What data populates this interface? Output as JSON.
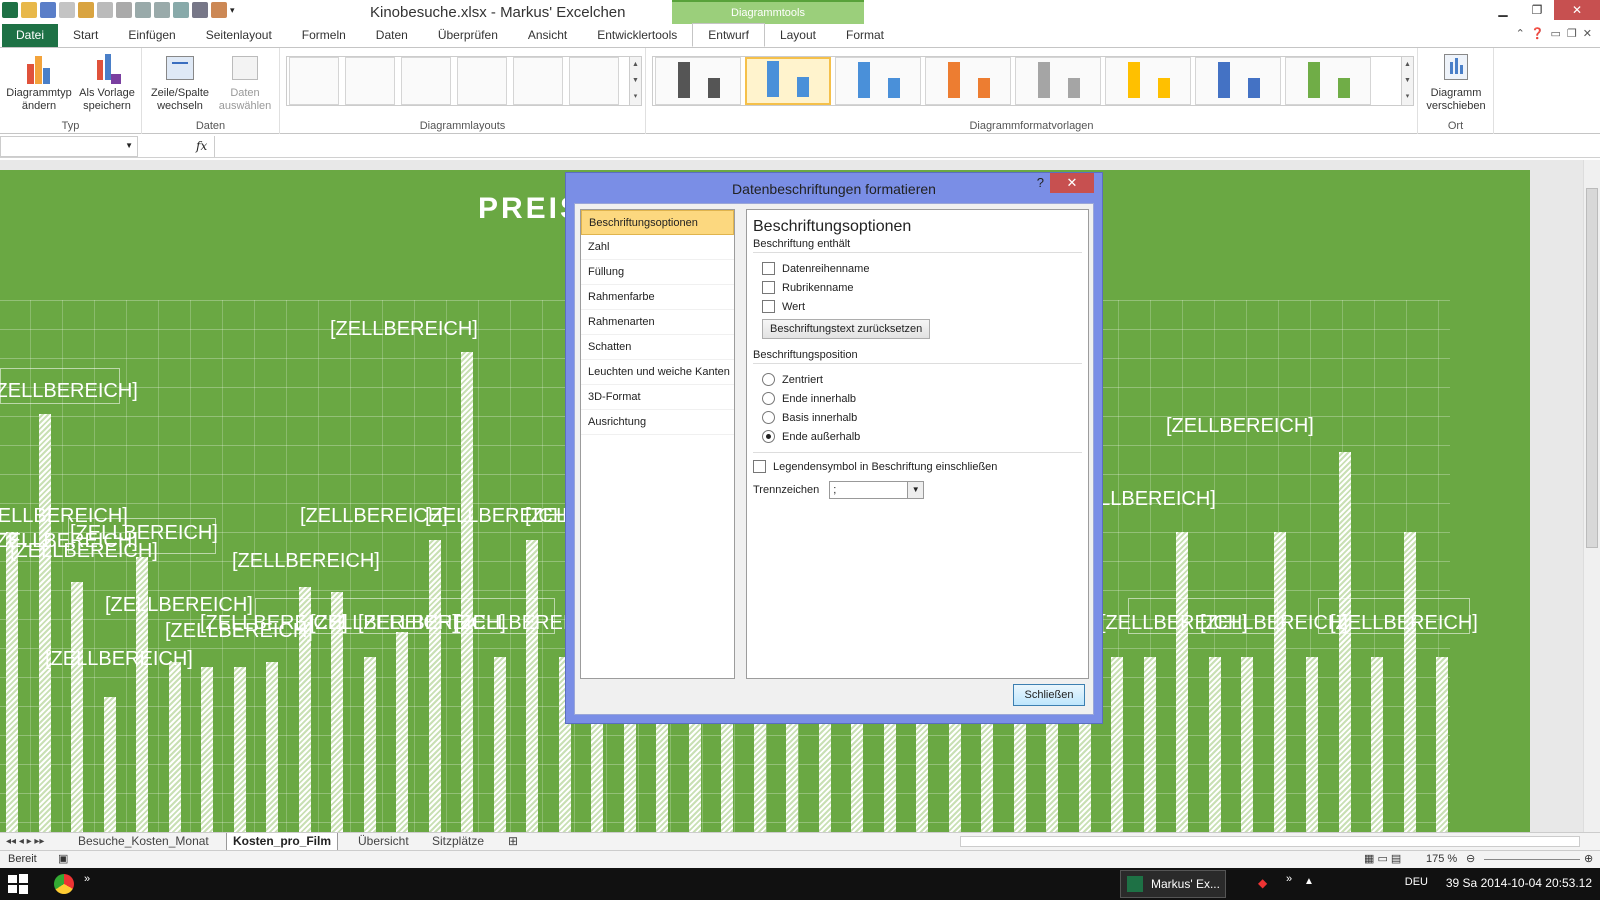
{
  "window": {
    "title": "Kinobesuche.xlsx  -  Markus' Excelchen",
    "context_group": "Diagrammtools"
  },
  "tabs": [
    "Datei",
    "Start",
    "Einfügen",
    "Seitenlayout",
    "Formeln",
    "Daten",
    "Überprüfen",
    "Ansicht",
    "Entwicklertools",
    "Entwurf",
    "Layout",
    "Format"
  ],
  "ribbon": {
    "typ": {
      "label": "Typ",
      "btn1": "Diagrammtyp ändern",
      "btn2": "Als Vorlage speichern"
    },
    "daten": {
      "label": "Daten",
      "btn1": "Zeile/Spalte wechseln",
      "btn2": "Daten auswählen"
    },
    "layouts_label": "Diagrammlayouts",
    "formats_label": "Diagrammformatvorlagen",
    "ort": {
      "label": "Ort",
      "btn": "Diagramm verschieben"
    }
  },
  "chart": {
    "title_visible": "PREIS",
    "label_text": "[ZELLBEREICH]"
  },
  "dialog": {
    "title": "Datenbeschriftungen formatieren",
    "help": "?",
    "nav": [
      "Beschriftungsoptionen",
      "Zahl",
      "Füllung",
      "Rahmenfarbe",
      "Rahmenarten",
      "Schatten",
      "Leuchten und weiche Kanten",
      "3D-Format",
      "Ausrichtung"
    ],
    "panel_title": "Beschriftungsoptionen",
    "contains_label": "Beschriftung enthält",
    "cb_series": "Datenreihenname",
    "cb_category": "Rubrikenname",
    "cb_value": "Wert",
    "reset_btn": "Beschriftungstext zurücksetzen",
    "position_label": "Beschriftungsposition",
    "rb_center": "Zentriert",
    "rb_inside_end": "Ende innerhalb",
    "rb_inside_base": "Basis innerhalb",
    "rb_outside_end": "Ende außerhalb",
    "legend_key": "Legendensymbol in Beschriftung einschließen",
    "separator_label": "Trennzeichen",
    "separator_value": ";",
    "close_btn": "Schließen"
  },
  "sheets": [
    "Besuche_Kosten_Monat",
    "Kosten_pro_Film",
    "Übersicht",
    "Sitzplätze"
  ],
  "status": {
    "ready": "Bereit",
    "zoom": "175 %"
  },
  "taskbar": {
    "app": "Markus' Ex...",
    "lang": "DEU",
    "clock": "39 Sa 2014-10-04 20:53.12"
  },
  "colors": {
    "excel_green": "#1e7145",
    "chart_bg": "#6aa843",
    "dialog_frame": "#7a8ee6"
  }
}
